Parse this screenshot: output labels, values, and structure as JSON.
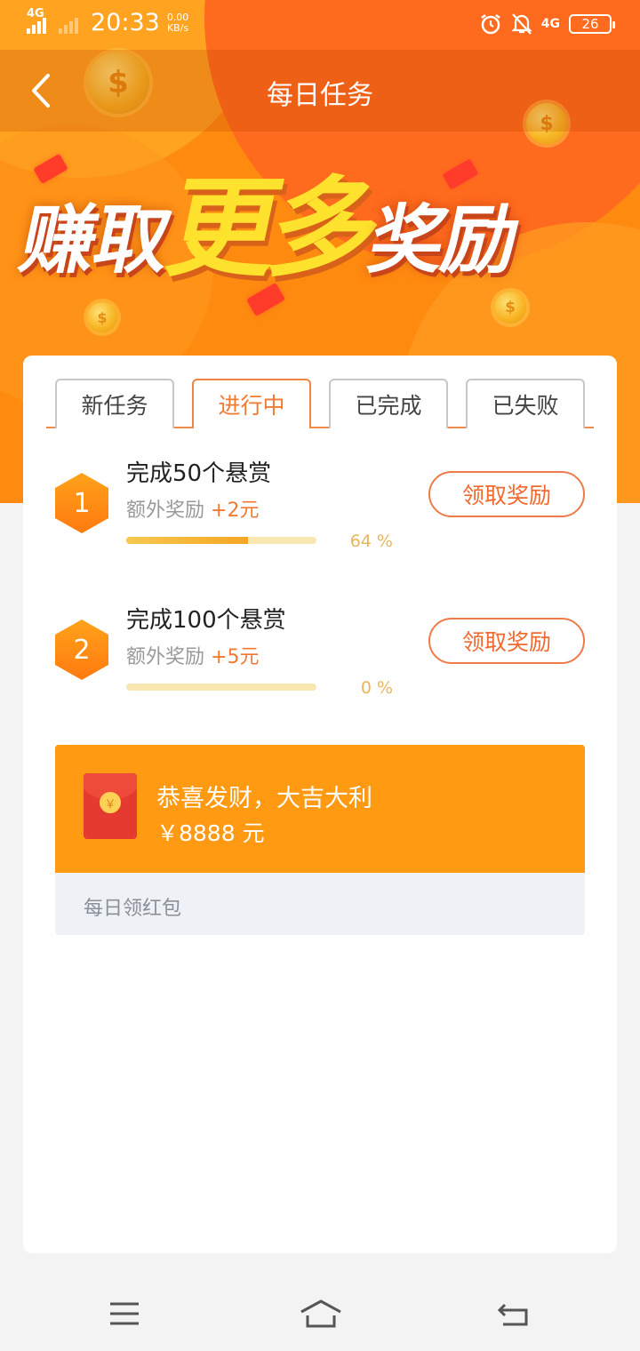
{
  "status_bar": {
    "network_left": "4G",
    "time": "20:33",
    "speed_value": "0.00",
    "speed_unit": "KB/s",
    "network_right": "4G",
    "battery": "26"
  },
  "nav": {
    "title": "每日任务"
  },
  "banner": {
    "headline_part1": "赚取",
    "headline_emphasis": "更多",
    "headline_part2": "奖励"
  },
  "tabs": [
    {
      "label": "新任务",
      "active": false
    },
    {
      "label": "进行中",
      "active": true
    },
    {
      "label": "已完成",
      "active": false
    },
    {
      "label": "已失败",
      "active": false
    }
  ],
  "tasks": [
    {
      "index": "1",
      "title": "完成50个悬赏",
      "reward_label": "额外奖励",
      "reward_amount": "+2",
      "reward_unit": "元",
      "progress": 0.64,
      "progress_text": "64 %",
      "button": "领取奖励"
    },
    {
      "index": "2",
      "title": "完成100个悬赏",
      "reward_label": "额外奖励",
      "reward_amount": "+5",
      "reward_unit": "元",
      "progress": 0,
      "progress_text": "0 %",
      "button": "领取奖励"
    }
  ],
  "red_packet": {
    "title": "恭喜发财，大吉大利",
    "amount": "￥8888 元",
    "footer": "每日领红包",
    "coin_symbol": "￥"
  },
  "colors": {
    "accent": "#ff8a10",
    "tab_active": "#f07a30",
    "packet_bg": "#ff9a12"
  }
}
